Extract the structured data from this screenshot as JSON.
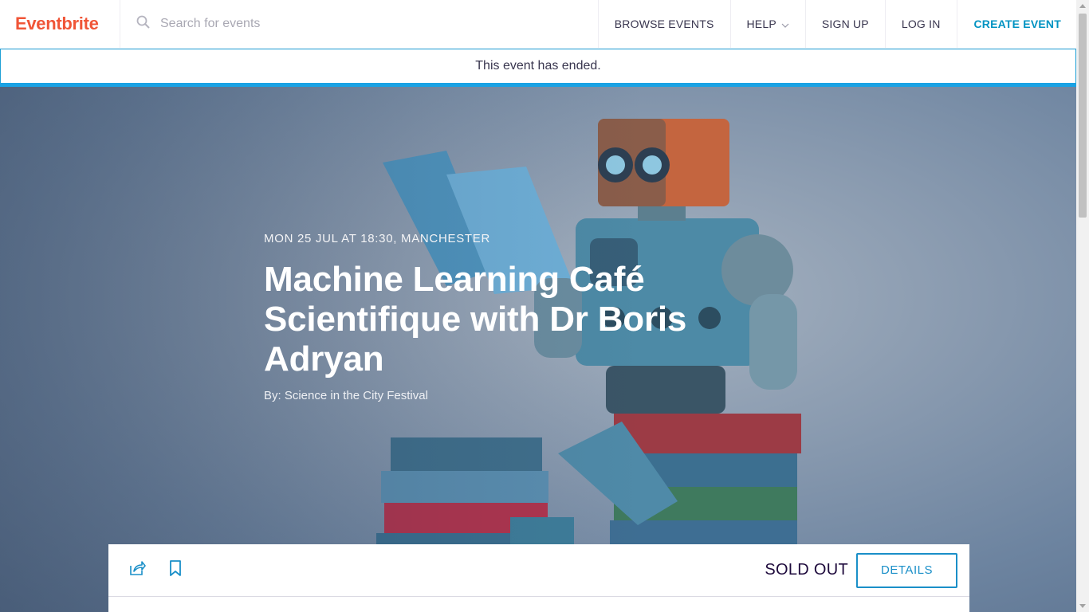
{
  "header": {
    "logo": "Eventbrite",
    "search_placeholder": "Search for events",
    "nav": {
      "browse": "BROWSE EVENTS",
      "help": "HELP",
      "signup": "SIGN UP",
      "login": "LOG IN",
      "create": "CREATE EVENT"
    }
  },
  "banner": {
    "message": "This event has ended."
  },
  "event": {
    "datetime_location": "MON 25 JUL AT 18:30, MANCHESTER",
    "title": "Machine Learning Café Scientifique with Dr Boris Adryan",
    "organizer": "By: Science in the City Festival"
  },
  "actions": {
    "status": "SOLD OUT",
    "details_label": "DETAILS",
    "share_icon": "share-icon",
    "bookmark_icon": "bookmark-icon"
  },
  "colors": {
    "brand": "#f05537",
    "accent": "#1a8fc8",
    "banner_border": "#1aa2e4"
  }
}
